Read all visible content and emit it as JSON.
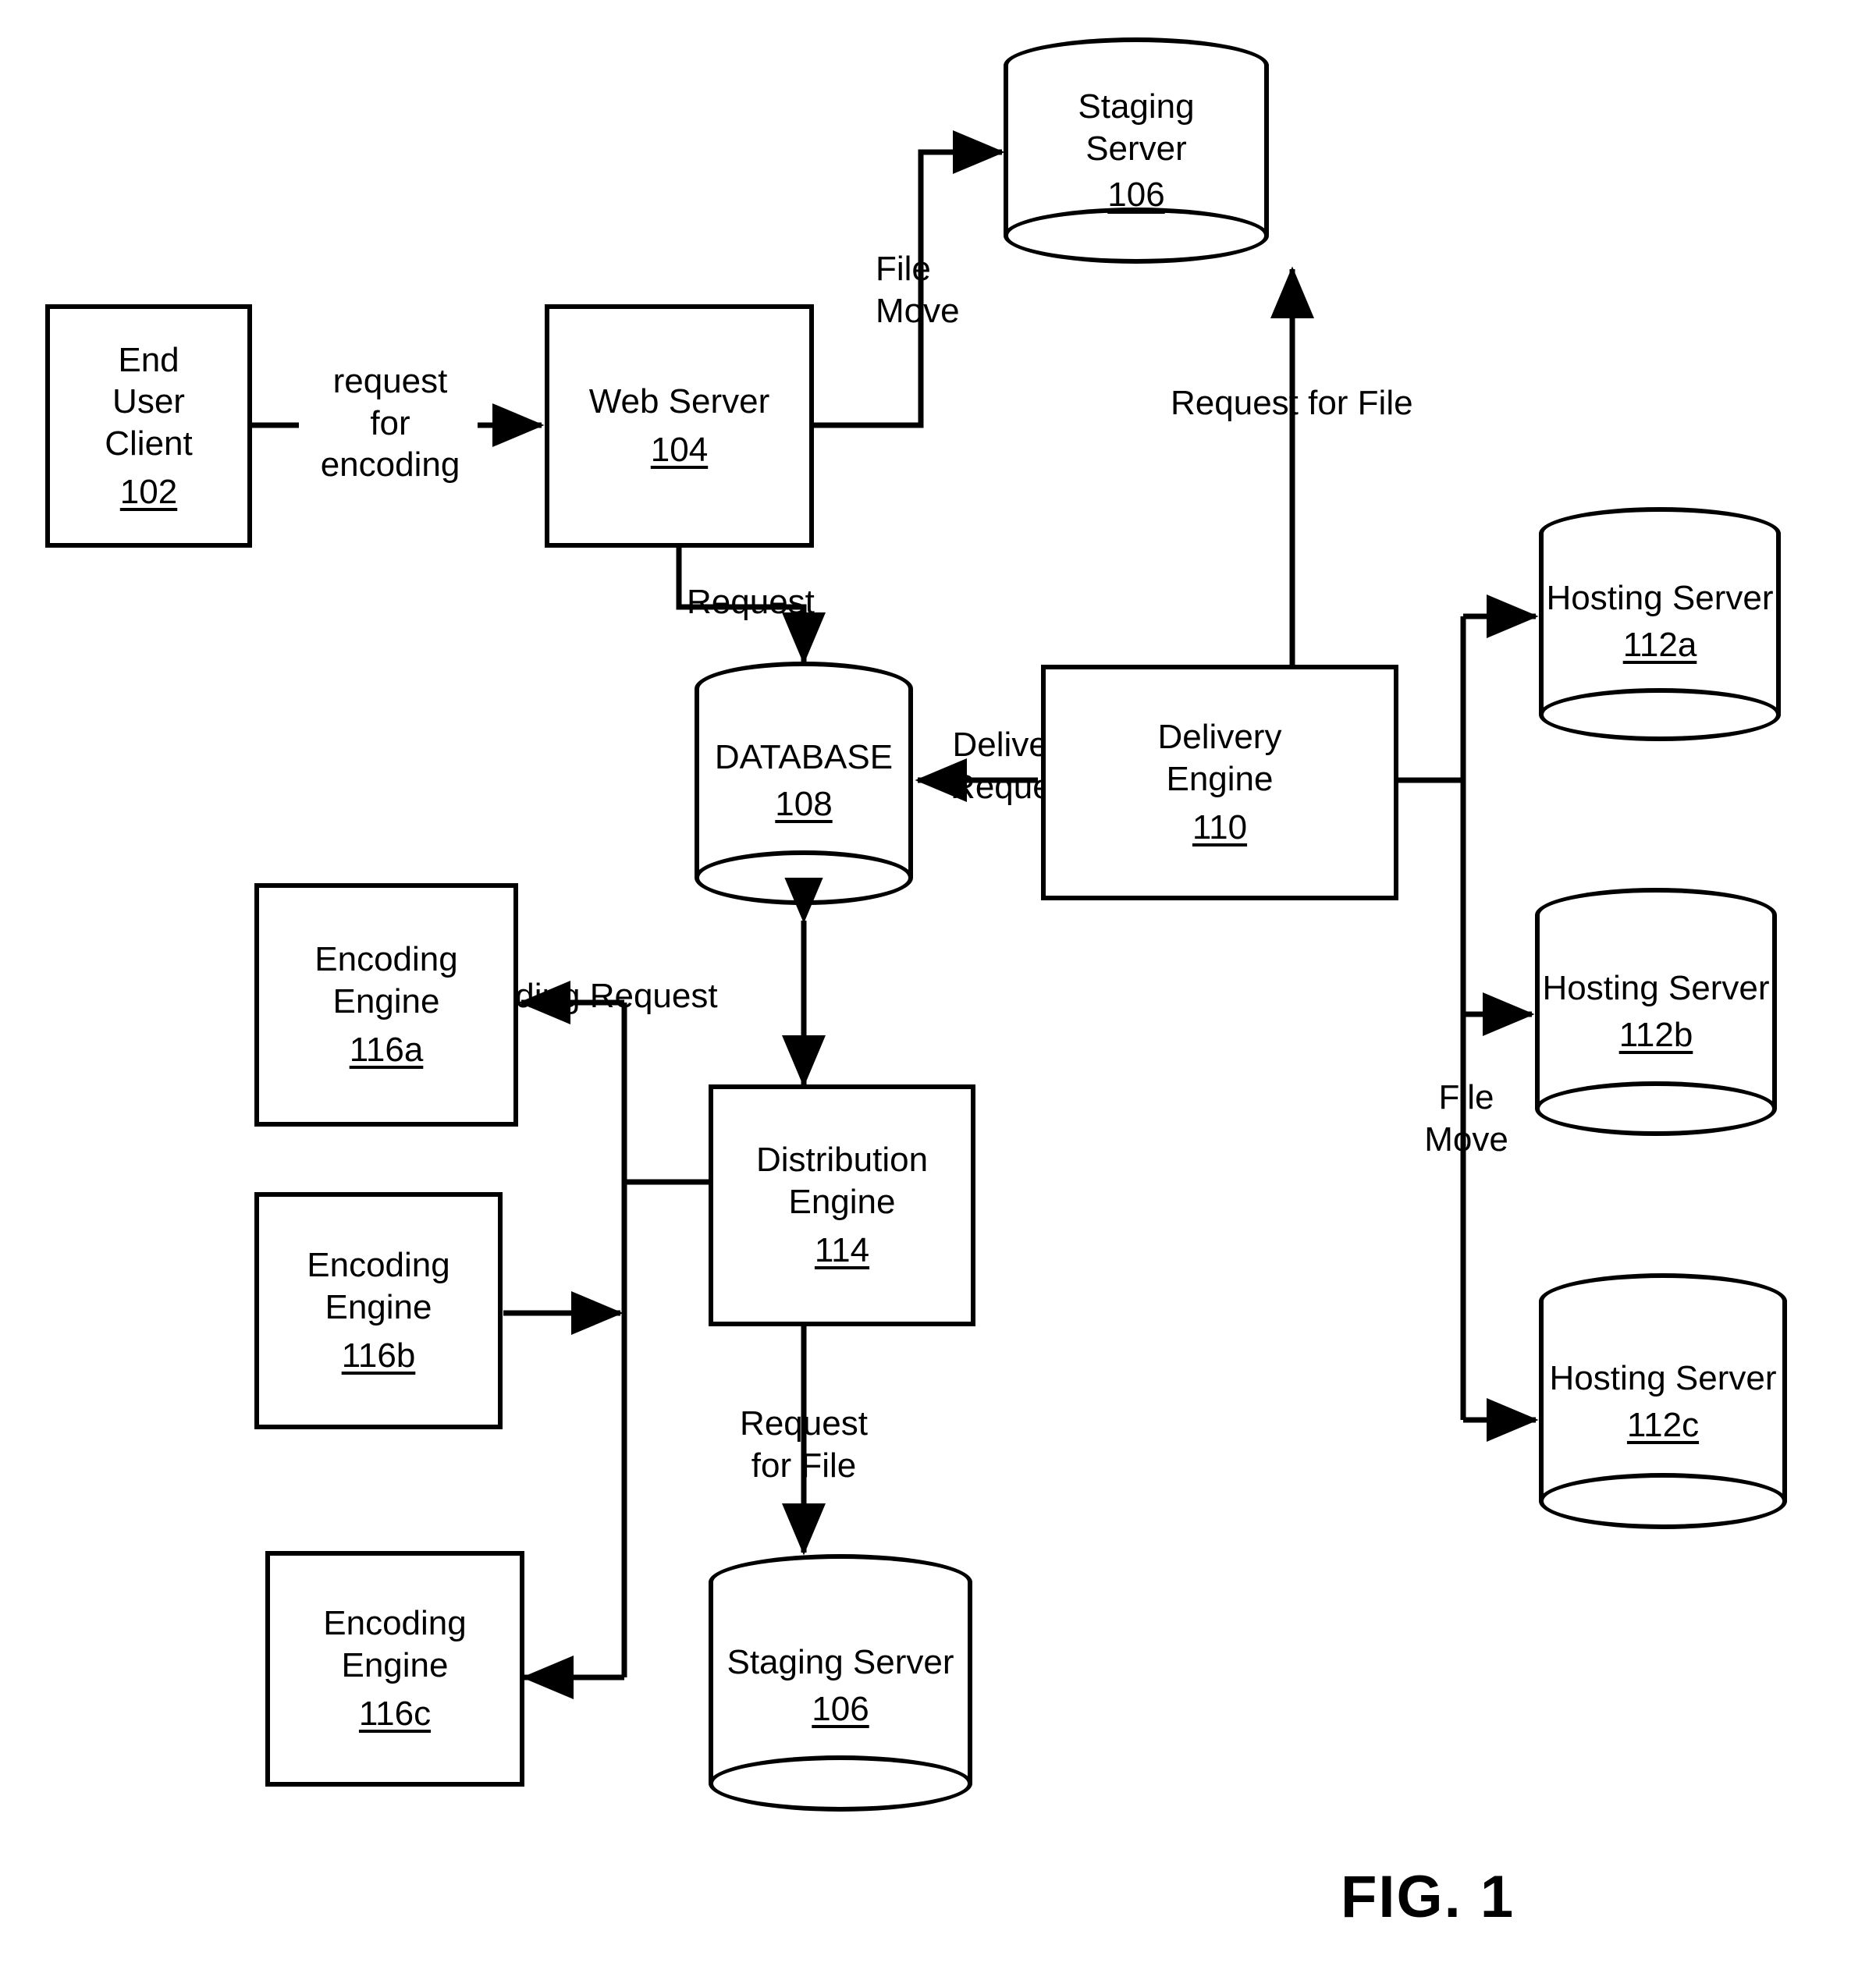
{
  "figure": {
    "caption": "FIG. 1",
    "nodes": {
      "end_user_client": {
        "line1": "End",
        "line2": "User",
        "line3": "Client",
        "ref": "102"
      },
      "web_server": {
        "line1": "Web Server",
        "ref": "104"
      },
      "staging_server_top": {
        "line1": "Staging",
        "line2": "Server",
        "ref": "106"
      },
      "database": {
        "line1": "DATABASE",
        "ref": "108"
      },
      "delivery_engine": {
        "line1": "Delivery",
        "line2": "Engine",
        "ref": "110"
      },
      "hosting_server_a": {
        "line1": "Hosting Server",
        "ref": "112a"
      },
      "hosting_server_b": {
        "line1": "Hosting Server",
        "ref": "112b"
      },
      "hosting_server_c": {
        "line1": "Hosting Server",
        "ref": "112c"
      },
      "distribution_engine": {
        "line1": "Distribution",
        "line2": "Engine",
        "ref": "114"
      },
      "encoding_engine_a": {
        "line1": "Encoding",
        "line2": "Engine",
        "ref": "116a"
      },
      "encoding_engine_b": {
        "line1": "Encoding",
        "line2": "Engine",
        "ref": "116b"
      },
      "encoding_engine_c": {
        "line1": "Encoding",
        "line2": "Engine",
        "ref": "116c"
      },
      "staging_server_bottom": {
        "line1": "Staging Server",
        "ref": "106"
      }
    },
    "edge_labels": {
      "request_for_encoding": "request\nfor\nencoding",
      "file_move_top": "File\nMove",
      "request_web_to_db": "Request",
      "request_for_file_top": "Request for File",
      "delivery_request": "Delivery\nRequest",
      "file_move_right": "File\nMove",
      "encoding_request": "Encoding Request",
      "request_for_file_bottom": "Request\nfor File"
    },
    "colors": {
      "ink": "#000000",
      "paper": "#ffffff"
    }
  }
}
